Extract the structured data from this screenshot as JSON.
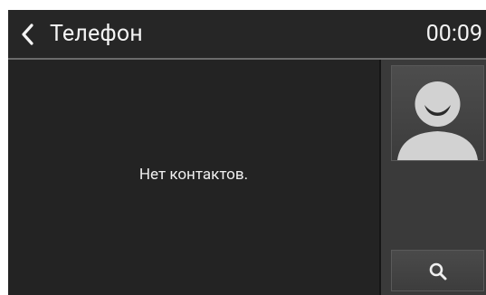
{
  "header": {
    "title": "Телефон",
    "clock": "00:09",
    "back_icon": "chevron-left-icon"
  },
  "main": {
    "empty_message": "Нет контактов."
  },
  "sidebar": {
    "avatar_icon": "contact-avatar-icon",
    "search_icon": "search-icon"
  },
  "colors": {
    "background": "#202020",
    "header": "#262626",
    "sidebar": "#3a3a3a",
    "text": "#f4f4f4"
  }
}
